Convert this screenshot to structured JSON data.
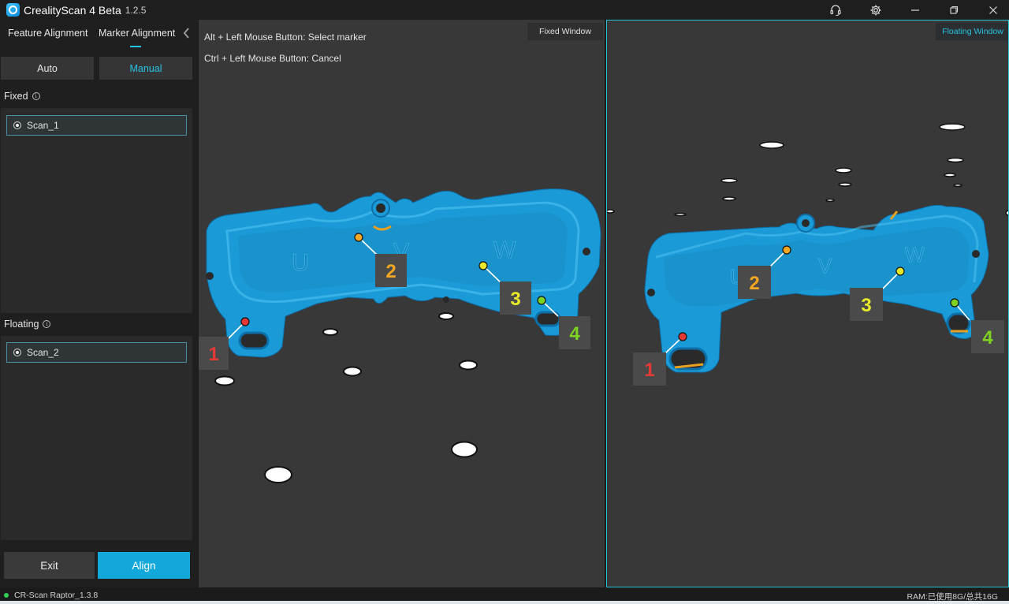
{
  "app": {
    "title": "CrealityScan 4 Beta",
    "version": "1.2.5"
  },
  "titlebar": {
    "support_icon": "headset-icon",
    "settings_icon": "gear-icon",
    "minimize_icon": "minimize-icon",
    "restore_icon": "restore-icon",
    "close_icon": "close-icon"
  },
  "left_panel": {
    "tabs": [
      {
        "label": "Feature Alignment"
      },
      {
        "label": "Marker Alignment",
        "active": true
      }
    ],
    "modes": {
      "auto": "Auto",
      "manual": "Manual",
      "selected": "Manual"
    },
    "fixed": {
      "label": "Fixed",
      "item": "Scan_1"
    },
    "floating": {
      "label": "Floating",
      "item": "Scan_2"
    },
    "buttons": {
      "exit": "Exit",
      "align": "Align"
    }
  },
  "fixed_view": {
    "label": "Fixed Window",
    "hints": [
      "Alt + Left Mouse Button: Select marker",
      "Ctrl + Left Mouse Button: Cancel"
    ],
    "markers": [
      {
        "n": "1",
        "color": "#e53935"
      },
      {
        "n": "2",
        "color": "#f5a623"
      },
      {
        "n": "3",
        "color": "#e8e82a"
      },
      {
        "n": "4",
        "color": "#7ed321"
      }
    ],
    "part_letters": [
      "U",
      "V",
      "W"
    ]
  },
  "floating_view": {
    "label": "Floating Window",
    "markers": [
      {
        "n": "1",
        "color": "#e53935"
      },
      {
        "n": "2",
        "color": "#f5a623"
      },
      {
        "n": "3",
        "color": "#e8e82a"
      },
      {
        "n": "4",
        "color": "#7ed321"
      }
    ],
    "part_letters": [
      "U",
      "V",
      "W"
    ]
  },
  "status": {
    "device": "CR-Scan Raptor_1.3.8",
    "ram": "RAM:已使用8G/总共16G"
  },
  "colors": {
    "accent": "#27c4e3",
    "part": "#1a9ad6",
    "align_button": "#12a8da"
  }
}
